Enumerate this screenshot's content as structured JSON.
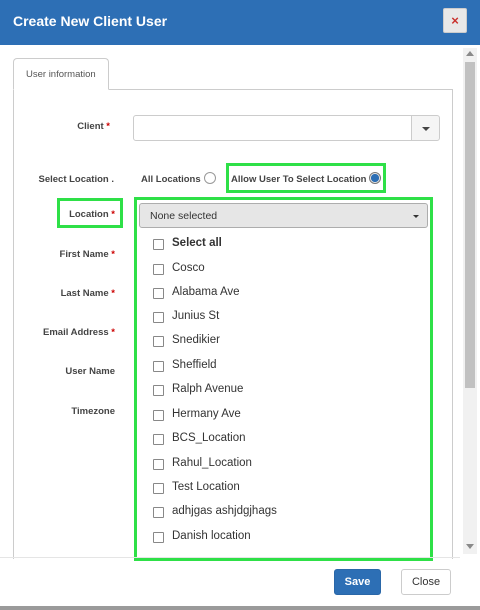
{
  "modal": {
    "title": "Create New Client User",
    "close_icon": "×"
  },
  "tab": {
    "label": "User information"
  },
  "form": {
    "client_label": "Client",
    "required_mark": "*",
    "client_value": "",
    "select_location_label": "Select Location .",
    "option_all_locations": "All Locations",
    "option_allow_user": "Allow User To Select Location",
    "location_label": "Location",
    "first_name_label": "First Name",
    "last_name_label": "Last Name",
    "email_label": "Email Address",
    "user_name_label": "User Name",
    "timezone_label": "Timezone"
  },
  "location_select": {
    "placeholder": "None selected",
    "options": [
      "Select all",
      "Cosco",
      "Alabama Ave",
      "Junius St",
      "Snedikier",
      "Sheffield",
      "Ralph Avenue",
      "Hermany Ave",
      "BCS_Location",
      "Rahul_Location",
      "Test Location",
      "adhjgas ashjdgjhags",
      "Danish location"
    ]
  },
  "footer": {
    "save_label": "Save",
    "close_label": "Close"
  },
  "colors": {
    "header": "#2d6fb5",
    "highlight": "#2ee047",
    "required": "#cc0000"
  }
}
